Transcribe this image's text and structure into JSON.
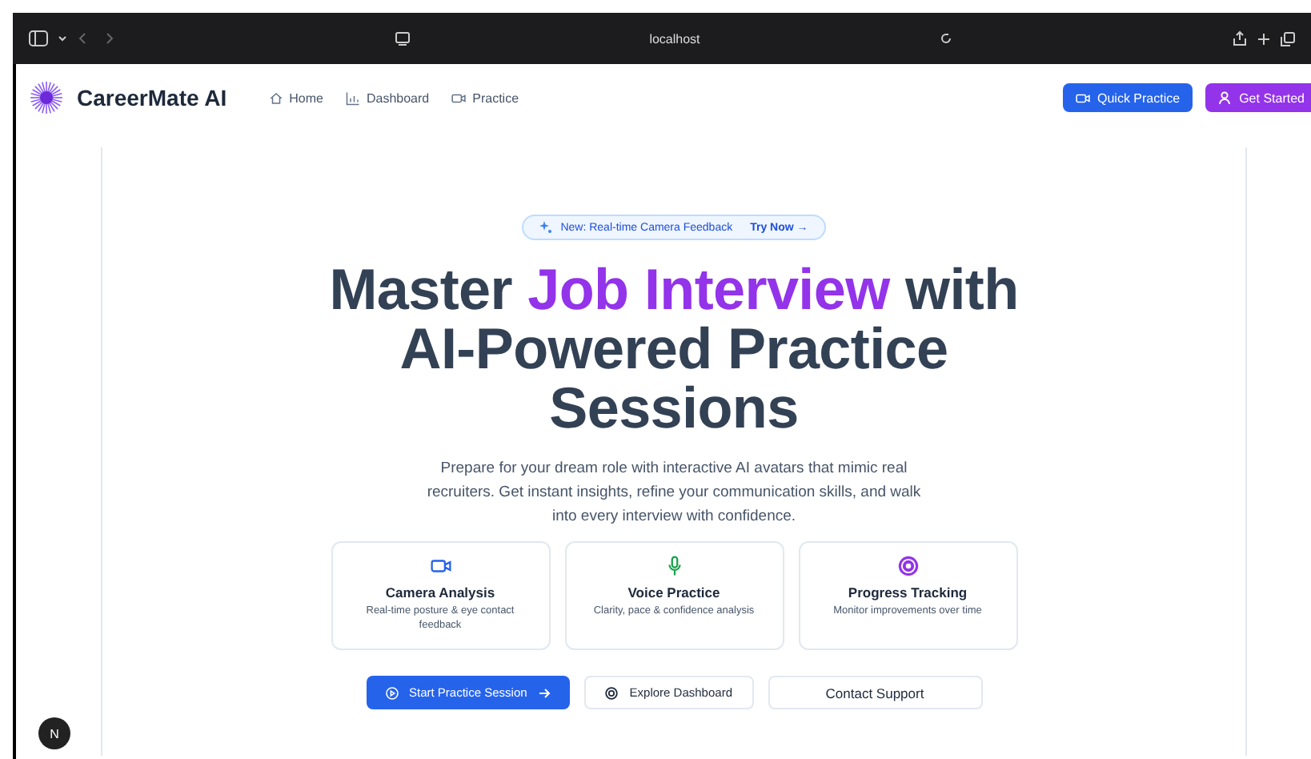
{
  "browser": {
    "address": "localhost"
  },
  "nav": {
    "brand": "CareerMate AI",
    "links": [
      {
        "label": "Home",
        "kind": "home"
      },
      {
        "label": "Dashboard",
        "kind": "chart"
      },
      {
        "label": "Practice",
        "kind": "video"
      }
    ],
    "quick_button": "Quick Practice",
    "start_button": "Get Started"
  },
  "badge": {
    "text": "New: Real-time Camera Feedback",
    "action": "Try Now →"
  },
  "heading": {
    "before": "Master ",
    "highlight": "Job Interview",
    "after": " with AI-Powered Practice Sessions"
  },
  "intro": "Prepare for your dream role with interactive AI avatars that mimic real recruiters. Get instant insights, refine your communication skills, and walk into every interview with confidence.",
  "features": [
    {
      "kind": "video",
      "color": "#2563eb",
      "title": "Camera Analysis",
      "text": "Real-time posture & eye contact feedback"
    },
    {
      "kind": "mic",
      "color": "#16a34a",
      "title": "Voice Practice",
      "text": "Clarity, pace & confidence analysis"
    },
    {
      "kind": "target",
      "color": "#9333ea",
      "title": "Progress Tracking",
      "text": "Monitor improvements over time"
    }
  ],
  "actions": [
    {
      "kind": "primary",
      "label": "Start Practice Session"
    },
    {
      "kind": "outline",
      "label": "Explore Dashboard"
    },
    {
      "kind": "plain",
      "label": "Contact Support"
    }
  ],
  "dev_badge": "N"
}
